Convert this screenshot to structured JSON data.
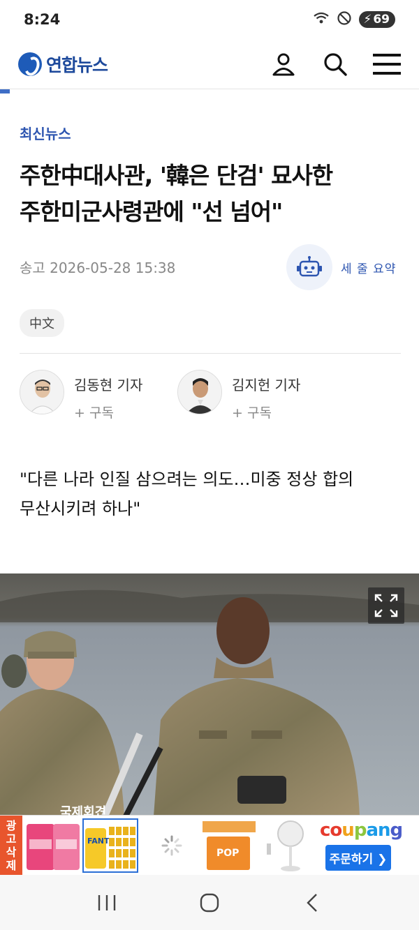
{
  "status_bar": {
    "time": "8:24",
    "battery": "69"
  },
  "header": {
    "brand": "연합뉴스"
  },
  "article": {
    "category": "최신뉴스",
    "title_line1": "주한中대사관, '韓은 단검' 묘사한",
    "title_line2": "주한미군사령관에 \"선 넘어\"",
    "sent": "송고 2026-05-28 15:38",
    "summary_label": "세 줄 요약",
    "lang_chip": "中文",
    "reporters": [
      {
        "name": "김동현 기자",
        "subscribe": "+ 구독"
      },
      {
        "name": "김지헌 기자",
        "subscribe": "+ 구독"
      }
    ],
    "subhead_line1": "\"다른 나라 인질 삼으려는 의도…미중 정상 합의",
    "subhead_line2": "무산시키려 하나\""
  },
  "photo": {
    "caption_overlay": "국제회견"
  },
  "ad": {
    "tag": [
      "광",
      "고",
      "삭",
      "제"
    ],
    "items": [
      {
        "icon": "supplement-bottles"
      },
      {
        "icon": "fanta-cans"
      },
      {
        "icon": "loading-spinner"
      },
      {
        "icon": "snack-box"
      },
      {
        "icon": "electric-fan"
      }
    ],
    "brand": "coupang",
    "order_label": "주문하기 ❯",
    "brand_colors": [
      "#e63b2e",
      "#f0a21c",
      "#8cc63f",
      "#1a9be8",
      "#4a5cc9"
    ]
  },
  "colors": {
    "accent": "#2d55b0",
    "ad_tag": "#e8552d",
    "coupang_button": "#1a73e8"
  }
}
